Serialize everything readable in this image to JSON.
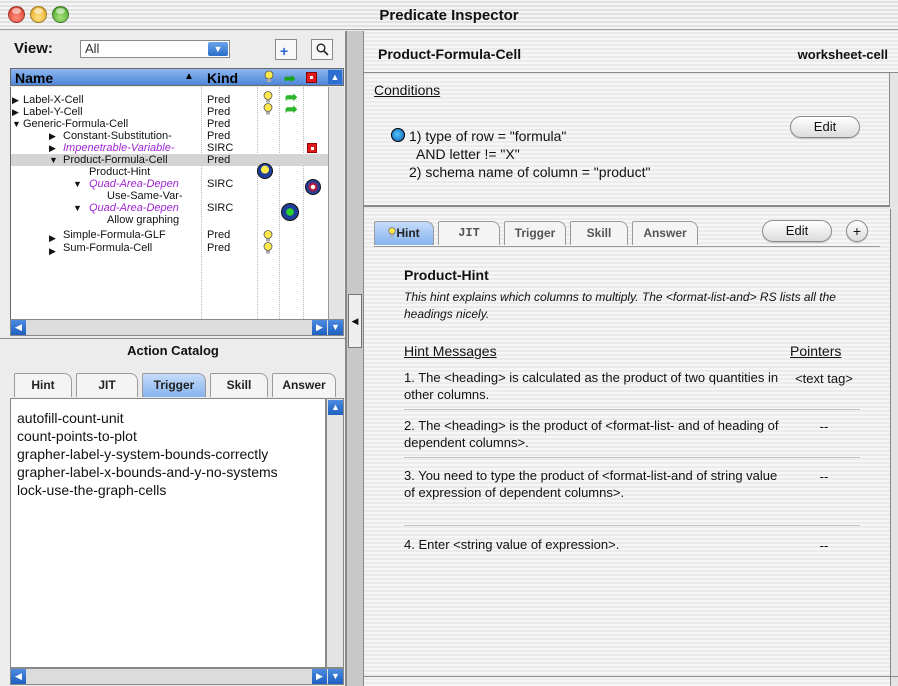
{
  "window": {
    "title": "Predicate Inspector"
  },
  "left": {
    "view_label": "View:",
    "view_value": "All",
    "new_icon": "new-document-icon",
    "search_icon": "magnifier-icon",
    "tree_headers": {
      "name": "Name",
      "kind": "Kind"
    },
    "tree_rows": [
      {
        "label": "Label-X-Cell",
        "kind": "Pred"
      },
      {
        "label": "Label-Y-Cell",
        "kind": "Pred"
      },
      {
        "label": "Generic-Formula-Cell",
        "kind": "Pred"
      },
      {
        "label": "Constant-Substitution-",
        "kind": "Pred"
      },
      {
        "label": "Impenetrable-Variable-",
        "kind": "SIRC"
      },
      {
        "label": "Product-Formula-Cell",
        "kind": "Pred"
      },
      {
        "label": "Product-Hint",
        "kind": ""
      },
      {
        "label": "Quad-Area-Depen",
        "kind": "SIRC"
      },
      {
        "label": "Use-Same-Var-",
        "kind": ""
      },
      {
        "label": "Quad-Area-Depen",
        "kind": "SIRC"
      },
      {
        "label": "Allow graphing",
        "kind": ""
      },
      {
        "label": "Simple-Formula-GLF",
        "kind": "Pred"
      },
      {
        "label": "Sum-Formula-Cell",
        "kind": "Pred"
      }
    ]
  },
  "action_catalog": {
    "title": "Action Catalog",
    "tabs": [
      "Hint",
      "JIT",
      "Trigger",
      "Skill",
      "Answer"
    ],
    "active_tab": "Trigger",
    "items": [
      "autofill-count-unit",
      "count-points-to-plot",
      "grapher-label-y-system-bounds-correctly",
      "grapher-label-x-bounds-and-y-no-systems",
      "lock-use-the-graph-cells"
    ]
  },
  "right": {
    "cell_name": "Product-Formula-Cell",
    "cell_type": "worksheet-cell",
    "conditions": {
      "heading": "Conditions",
      "lines": [
        "1) type of row = \"formula\"",
        "AND letter != \"X\"",
        "2) schema name of column = \"product\""
      ],
      "edit_label": "Edit"
    },
    "hint_tabs": [
      "Hint",
      "JIT",
      "Trigger",
      "Skill",
      "Answer"
    ],
    "active_hint_tab": "Hint",
    "edit_label": "Edit",
    "add_label": "+",
    "hint": {
      "name": "Product-Hint",
      "description": "This hint explains which columns to multiply. The <format-list-and> RS lists all the headings nicely.",
      "messages_heading": "Hint Messages",
      "pointers_heading": "Pointers",
      "messages": [
        {
          "text": "1. The <heading> is calculated as the product of two quantities in other columns.",
          "pointer": "<text tag>"
        },
        {
          "text": "2. The <heading> is the product of <format-list- and of heading of dependent columns>.",
          "pointer": "--"
        },
        {
          "text": "3. You need to type the product of <format-list-and of string value of expression of dependent columns>.",
          "pointer": "--"
        },
        {
          "text": "4. Enter <string value of expression>.",
          "pointer": "--"
        }
      ]
    }
  },
  "colors": {
    "accent_blue": "#4d86d8",
    "purple_item": "#a025d4",
    "selection": "#d4d4d4"
  }
}
